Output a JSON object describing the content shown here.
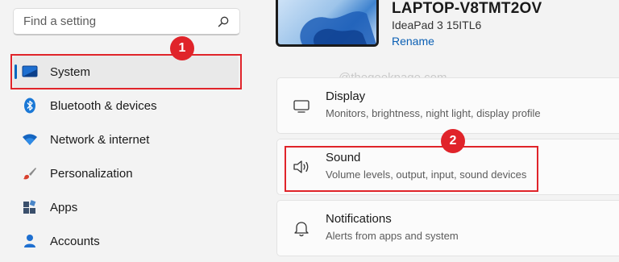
{
  "search": {
    "placeholder": "Find a setting",
    "icon": "search-icon"
  },
  "sidebar": {
    "items": [
      {
        "label": "System",
        "icon": "system-display-icon",
        "selected": true
      },
      {
        "label": "Bluetooth & devices",
        "icon": "bluetooth-icon"
      },
      {
        "label": "Network & internet",
        "icon": "wifi-icon"
      },
      {
        "label": "Personalization",
        "icon": "brush-icon"
      },
      {
        "label": "Apps",
        "icon": "apps-icon"
      },
      {
        "label": "Accounts",
        "icon": "person-icon"
      }
    ]
  },
  "device": {
    "name": "LAPTOP-V8TMT2OV",
    "model": "IdeaPad 3 15ITL6",
    "rename_label": "Rename"
  },
  "watermark": "@thegeekpage.com",
  "cards": [
    {
      "title": "Display",
      "subtitle": "Monitors, brightness, night light, display profile",
      "icon": "monitor-icon"
    },
    {
      "title": "Sound",
      "subtitle": "Volume levels, output, input, sound devices",
      "icon": "speaker-icon"
    },
    {
      "title": "Notifications",
      "subtitle": "Alerts from apps and system",
      "icon": "bell-icon"
    }
  ],
  "annotations": {
    "badge_1": "1",
    "badge_2": "2"
  },
  "colors": {
    "accent": "#0067c0",
    "highlight": "#e0242a",
    "link": "#0a5fb4"
  }
}
